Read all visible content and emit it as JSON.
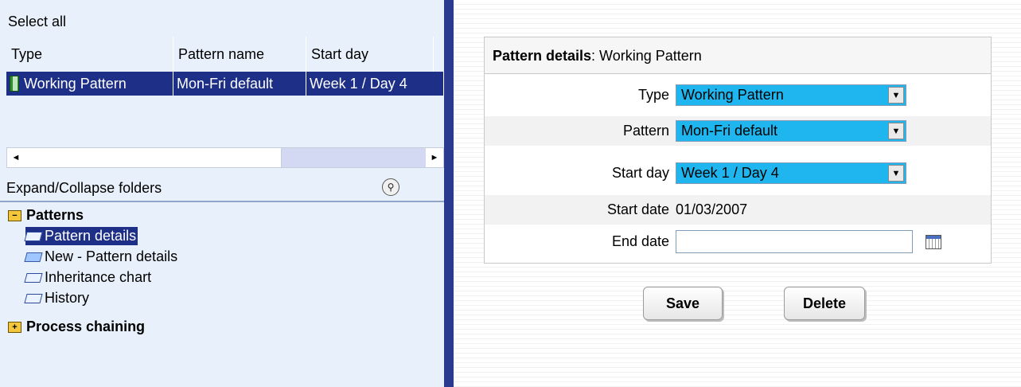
{
  "left": {
    "select_all": "Select all",
    "columns": [
      "Type",
      "Pattern name",
      "Start day"
    ],
    "rows": [
      {
        "type": "Working Pattern",
        "pattern_name": "Mon-Fri default",
        "start_day": "Week 1 / Day 4"
      }
    ],
    "scroll": {
      "left_arrow": "◄",
      "right_arrow": "►"
    },
    "expand_label": "Expand/Collapse folders",
    "tree": {
      "patterns_folder": "Patterns",
      "items": [
        "Pattern details",
        "New - Pattern details",
        "Inheritance chart",
        "History"
      ],
      "process_folder": "Process chaining"
    }
  },
  "details": {
    "heading_bold": "Pattern details",
    "heading_rest": ": Working Pattern",
    "type_label": "Type",
    "type_value": "Working Pattern",
    "pattern_label": "Pattern",
    "pattern_value": "Mon-Fri default",
    "start_day_label": "Start day",
    "start_day_value": "Week 1 / Day 4",
    "start_date_label": "Start date",
    "start_date_value": "01/03/2007",
    "end_date_label": "End date",
    "end_date_value": ""
  },
  "buttons": {
    "save": "Save",
    "delete": "Delete"
  },
  "colors": {
    "selection": "#1d2f86",
    "select_bg": "#1fb6ef",
    "left_bg": "#e8f0fb"
  },
  "icons": [
    "pattern-icon",
    "search-icon",
    "folder-open-icon",
    "folder-closed-icon",
    "document-icon",
    "new-document-icon",
    "calendar-icon",
    "dropdown-arrow-icon"
  ]
}
